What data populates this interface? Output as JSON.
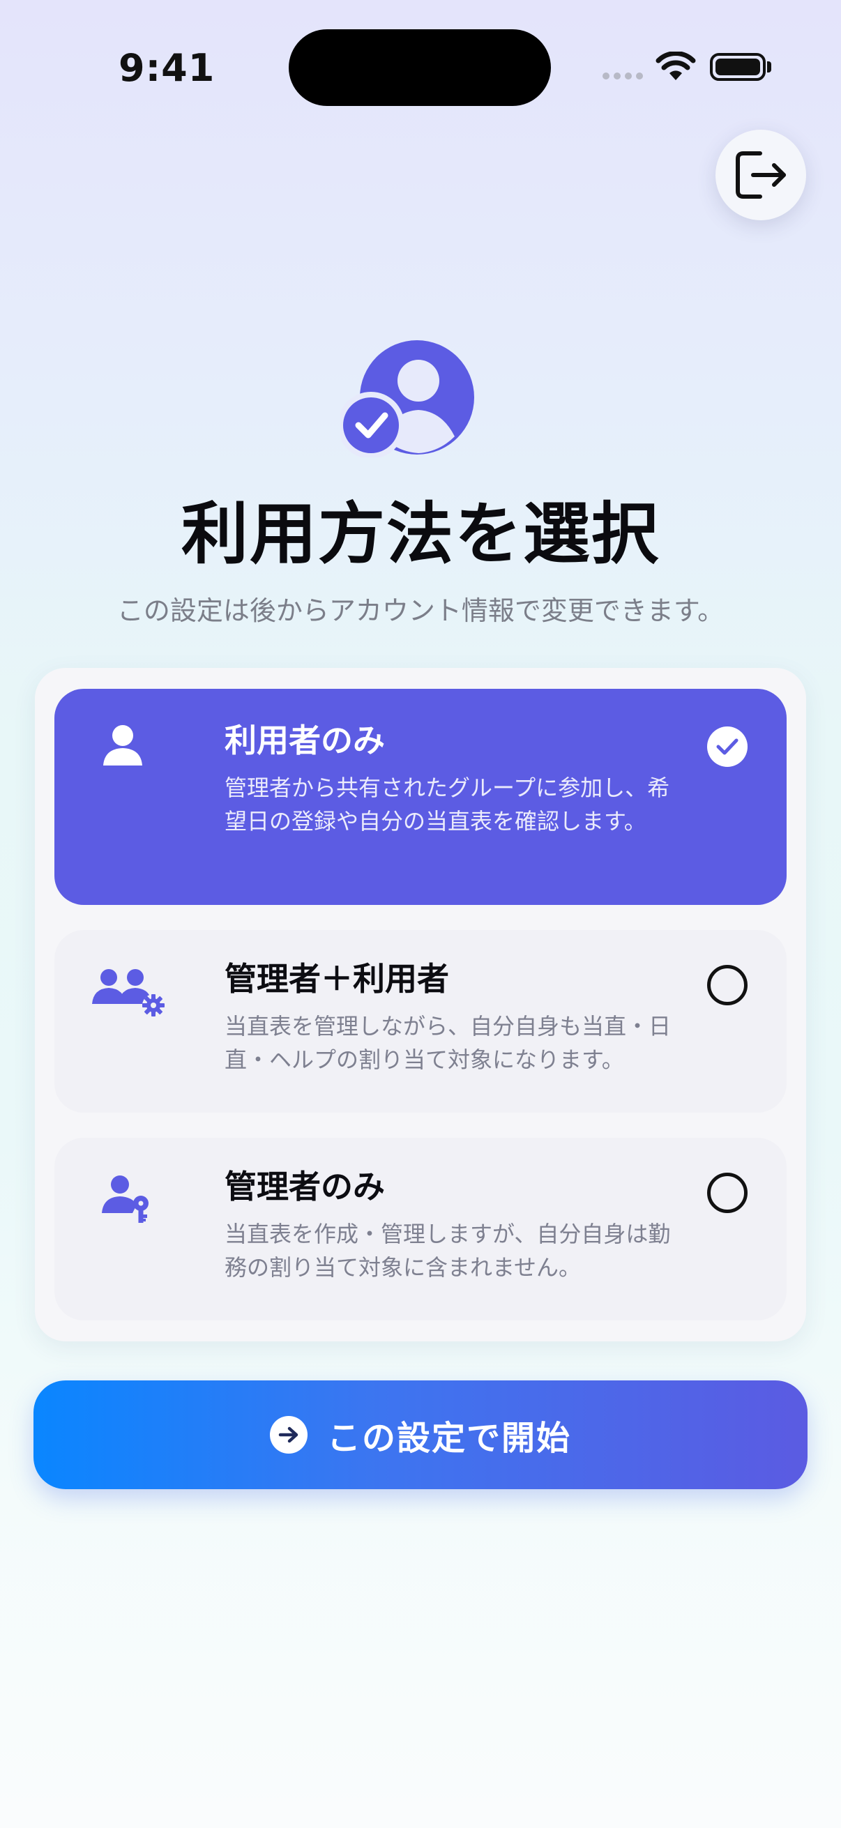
{
  "status_bar": {
    "time": "9:41"
  },
  "header": {
    "logout_icon": "logout-icon"
  },
  "hero": {
    "icon": "person-circle-check-icon",
    "title": "利用方法を選択",
    "subtitle": "この設定は後からアカウント情報で変更できます。"
  },
  "options": [
    {
      "icon": "person-icon",
      "title": "利用者のみ",
      "description": "管理者から共有されたグループに参加し、希望日の登録や自分の当直表を確認します。",
      "selected": true
    },
    {
      "icon": "people-gear-icon",
      "title": "管理者＋利用者",
      "description": "当直表を管理しながら、自分自身も当直・日直・ヘルプの割り当て対象になります。",
      "selected": false
    },
    {
      "icon": "person-key-icon",
      "title": "管理者のみ",
      "description": "当直表を作成・管理しますが、自分自身は勤務の割り当て対象に含まれません。",
      "selected": false
    }
  ],
  "start_button": {
    "label": "この設定で開始",
    "icon": "arrow-right-circle-icon"
  },
  "colors": {
    "accent": "#5C5CE3",
    "button_start": "#0A86FF",
    "button_end": "#5B5BE2",
    "muted_text": "#7B7E89"
  }
}
